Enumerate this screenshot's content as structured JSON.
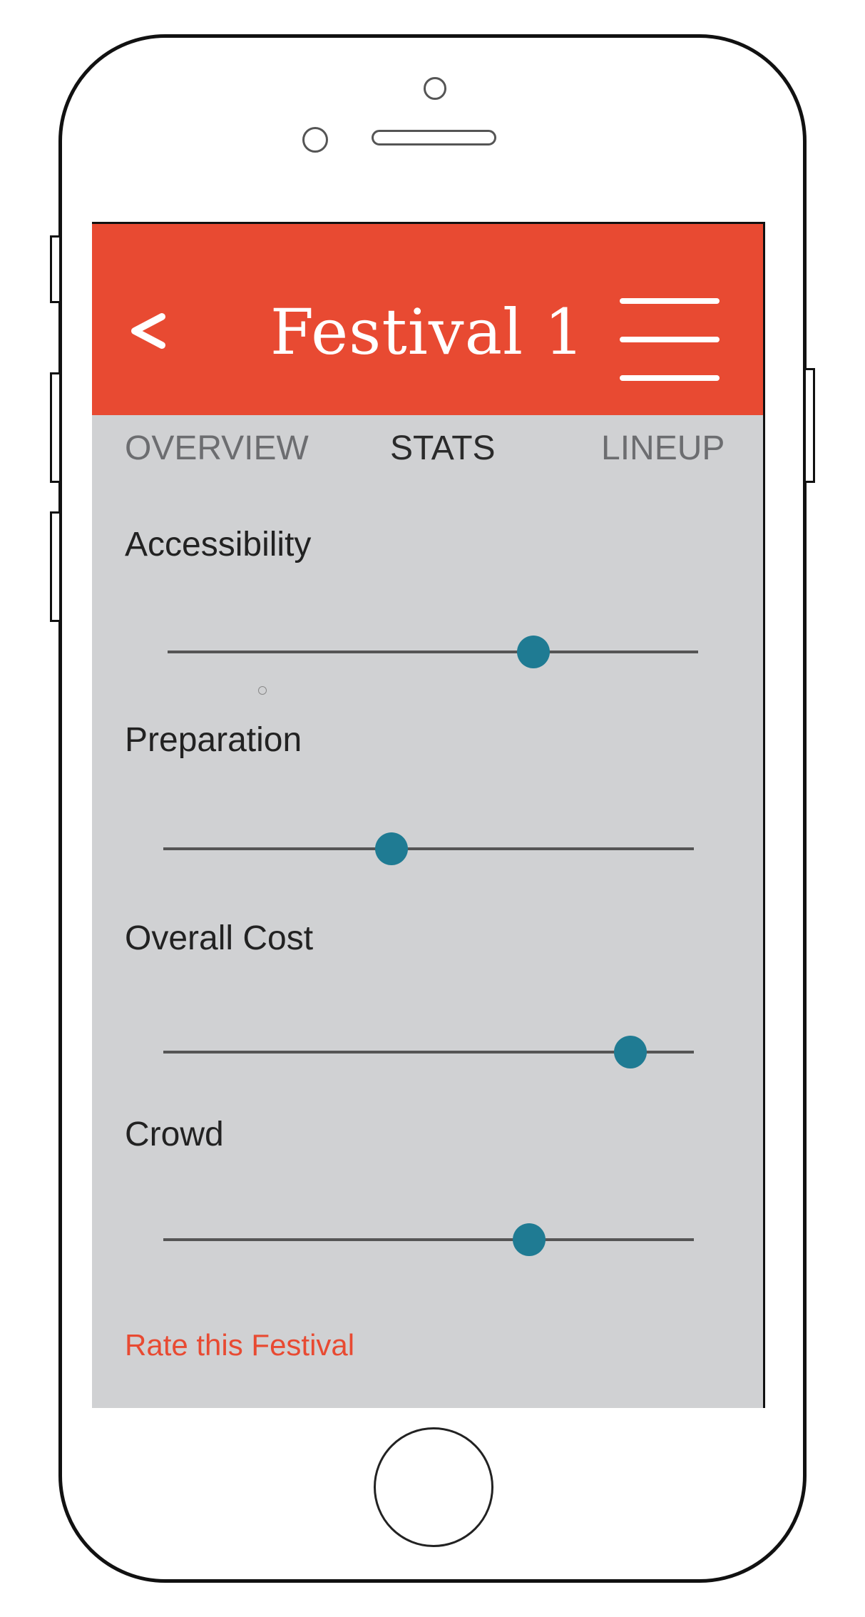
{
  "header": {
    "title": "Festival 1",
    "back_label": "<",
    "accent_color": "#e84a32"
  },
  "tabs": [
    {
      "label": "OVERVIEW",
      "active": false
    },
    {
      "label": "STATS",
      "active": true
    },
    {
      "label": "LINEUP",
      "active": false
    }
  ],
  "stats": [
    {
      "label": "Accessibility",
      "value": 0.69
    },
    {
      "label": "Preparation",
      "value": 0.43
    },
    {
      "label": "Overall Cost",
      "value": 0.88
    },
    {
      "label": "Crowd",
      "value": 0.69
    }
  ],
  "rate_link": "Rate this Festival",
  "colors": {
    "screen_bg": "#d0d1d3",
    "slider_thumb": "#1f7b93",
    "slider_track": "#555555"
  },
  "icons": {
    "back": "chevron-left-icon",
    "menu": "hamburger-menu-icon"
  }
}
